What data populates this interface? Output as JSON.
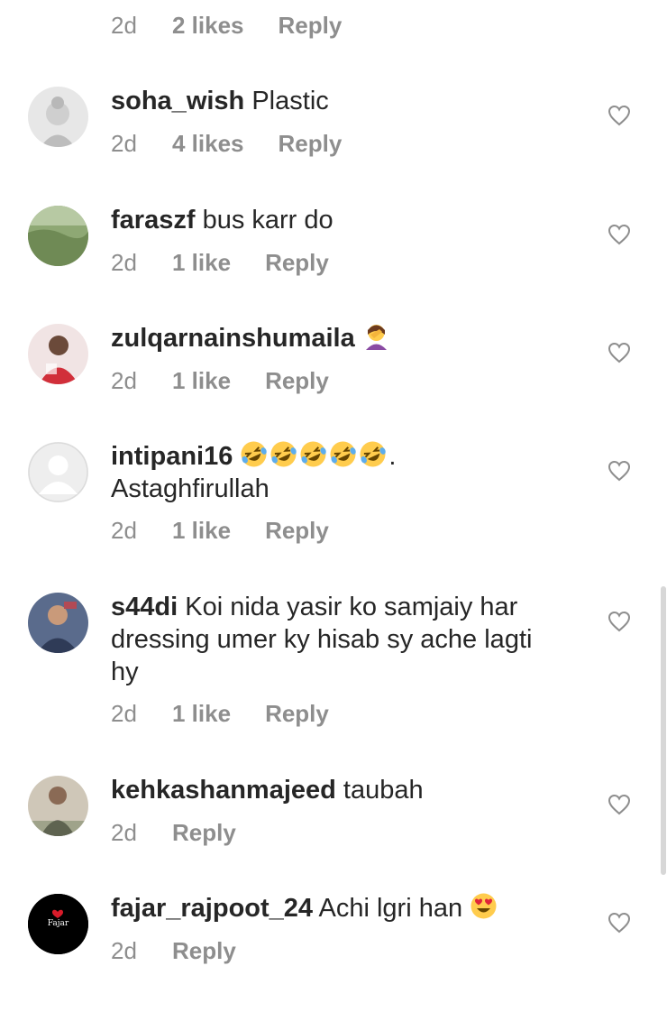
{
  "top_meta": {
    "ago": "2d",
    "likes": "2 likes",
    "reply": "Reply"
  },
  "comments": [
    {
      "username": "soha_wish",
      "text": "Plastic",
      "ago": "2d",
      "likes": "4 likes",
      "reply": "Reply"
    },
    {
      "username": "faraszf",
      "text": "bus karr do",
      "ago": "2d",
      "likes": "1 like",
      "reply": "Reply"
    },
    {
      "username": "zulqarnainshumaila",
      "text": "",
      "emoji": "woman-facepalming",
      "ago": "2d",
      "likes": "1 like",
      "reply": "Reply"
    },
    {
      "username": "intipani16",
      "text_after_emojis": ".",
      "text_line2": "Astaghfirullah",
      "emoji": "rolling-on-floor-laughing",
      "emoji_count": 5,
      "ago": "2d",
      "likes": "1 like",
      "reply": "Reply"
    },
    {
      "username": "s44di",
      "text": "Koi nida yasir ko samjaiy har dressing umer ky hisab sy ache lagti hy",
      "ago": "2d",
      "likes": "1 like",
      "reply": "Reply"
    },
    {
      "username": "kehkashanmajeed",
      "text": "taubah",
      "ago": "2d",
      "reply": "Reply"
    },
    {
      "username": "fajar_rajpoot_24",
      "text": "Achi lgri han",
      "emoji": "heart-eyes",
      "avatar_text": "Fajar",
      "ago": "2d",
      "reply": "Reply"
    }
  ],
  "colors": {
    "text": "#262626",
    "meta": "#8e8e8e",
    "heart_outline": "#8e8e8e"
  },
  "icons": {
    "like": "heart-outline-icon"
  }
}
